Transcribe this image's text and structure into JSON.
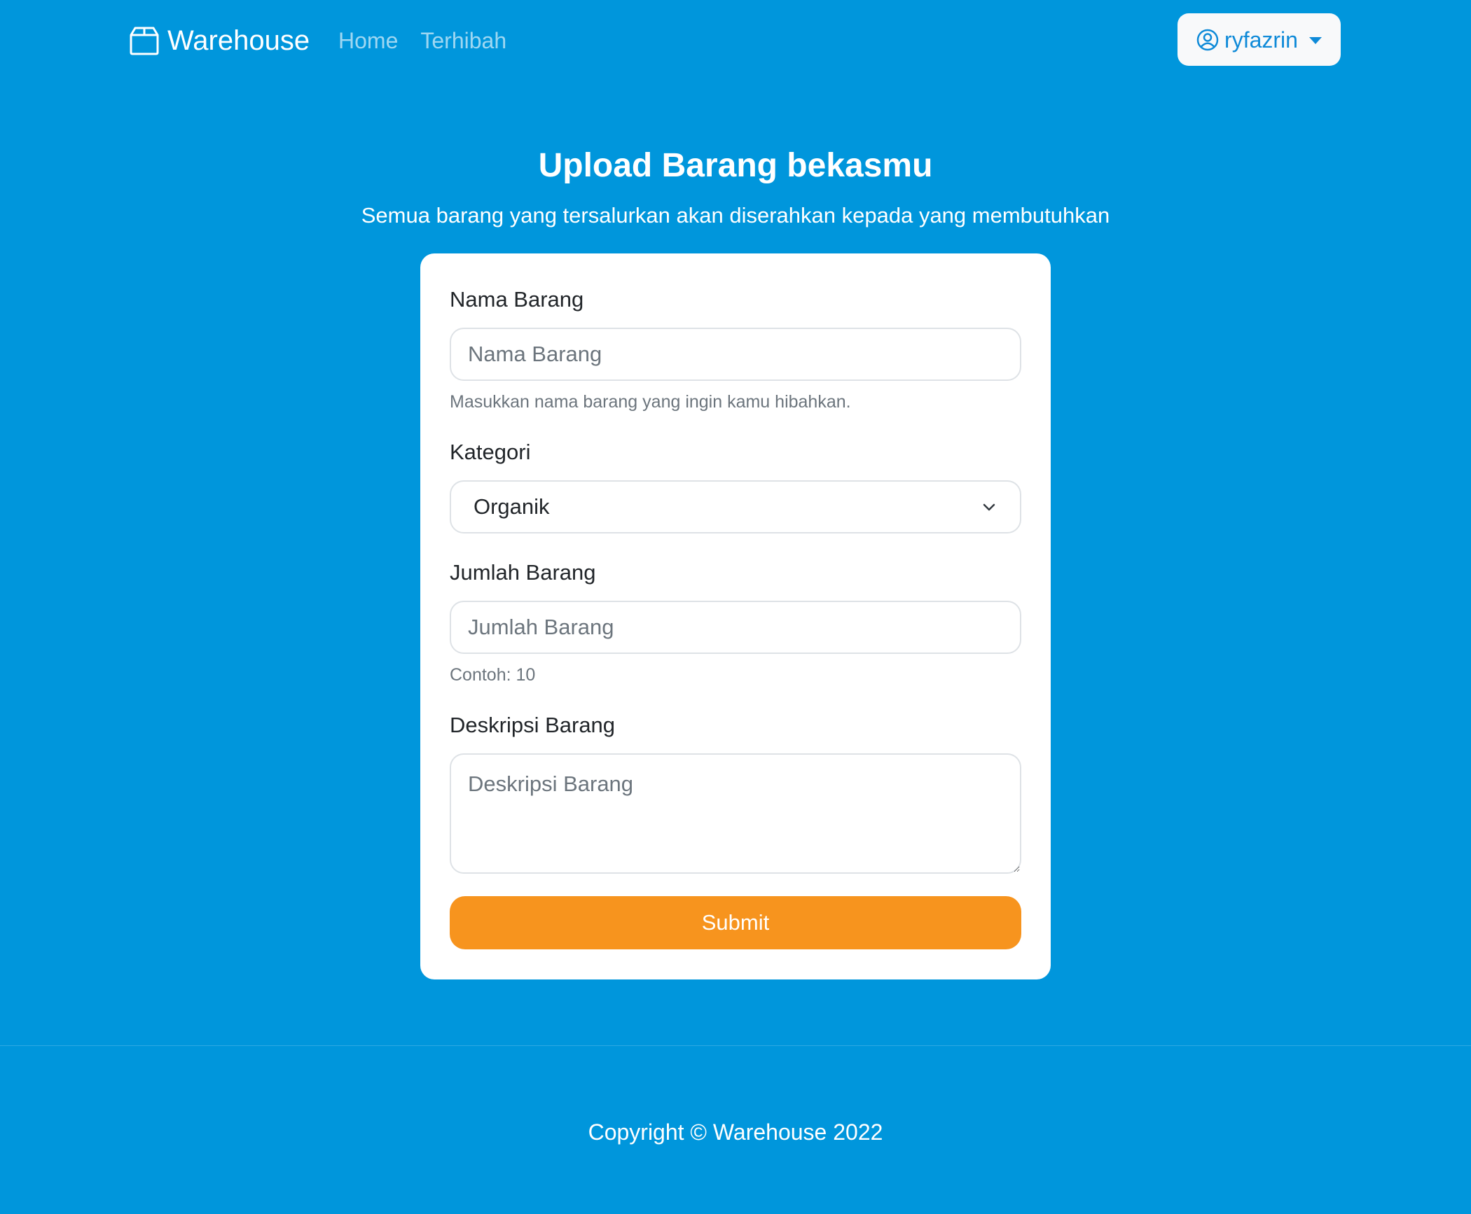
{
  "navbar": {
    "brand": "Warehouse",
    "brand_icon": "box-icon",
    "links": [
      "Home",
      "Terhibah"
    ],
    "user": {
      "name": "ryfazrin",
      "icon": "user-circle-icon"
    }
  },
  "header": {
    "title": "Upload Barang bekasmu",
    "subtitle": "Semua barang yang tersalurkan akan diserahkan kepada yang membutuhkan"
  },
  "form": {
    "nama_barang": {
      "label": "Nama Barang",
      "placeholder": "Nama Barang",
      "help": "Masukkan nama barang yang ingin kamu hibahkan."
    },
    "kategori": {
      "label": "Kategori",
      "selected": "Organik"
    },
    "jumlah_barang": {
      "label": "Jumlah Barang",
      "placeholder": "Jumlah Barang",
      "help": "Contoh: 10"
    },
    "deskripsi_barang": {
      "label": "Deskripsi Barang",
      "placeholder": "Deskripsi Barang"
    },
    "submit_label": "Submit"
  },
  "footer": {
    "copyright": "Copyright © Warehouse 2022"
  },
  "colors": {
    "background": "#0096dc",
    "accent_button": "#f7941e",
    "card": "#ffffff"
  }
}
